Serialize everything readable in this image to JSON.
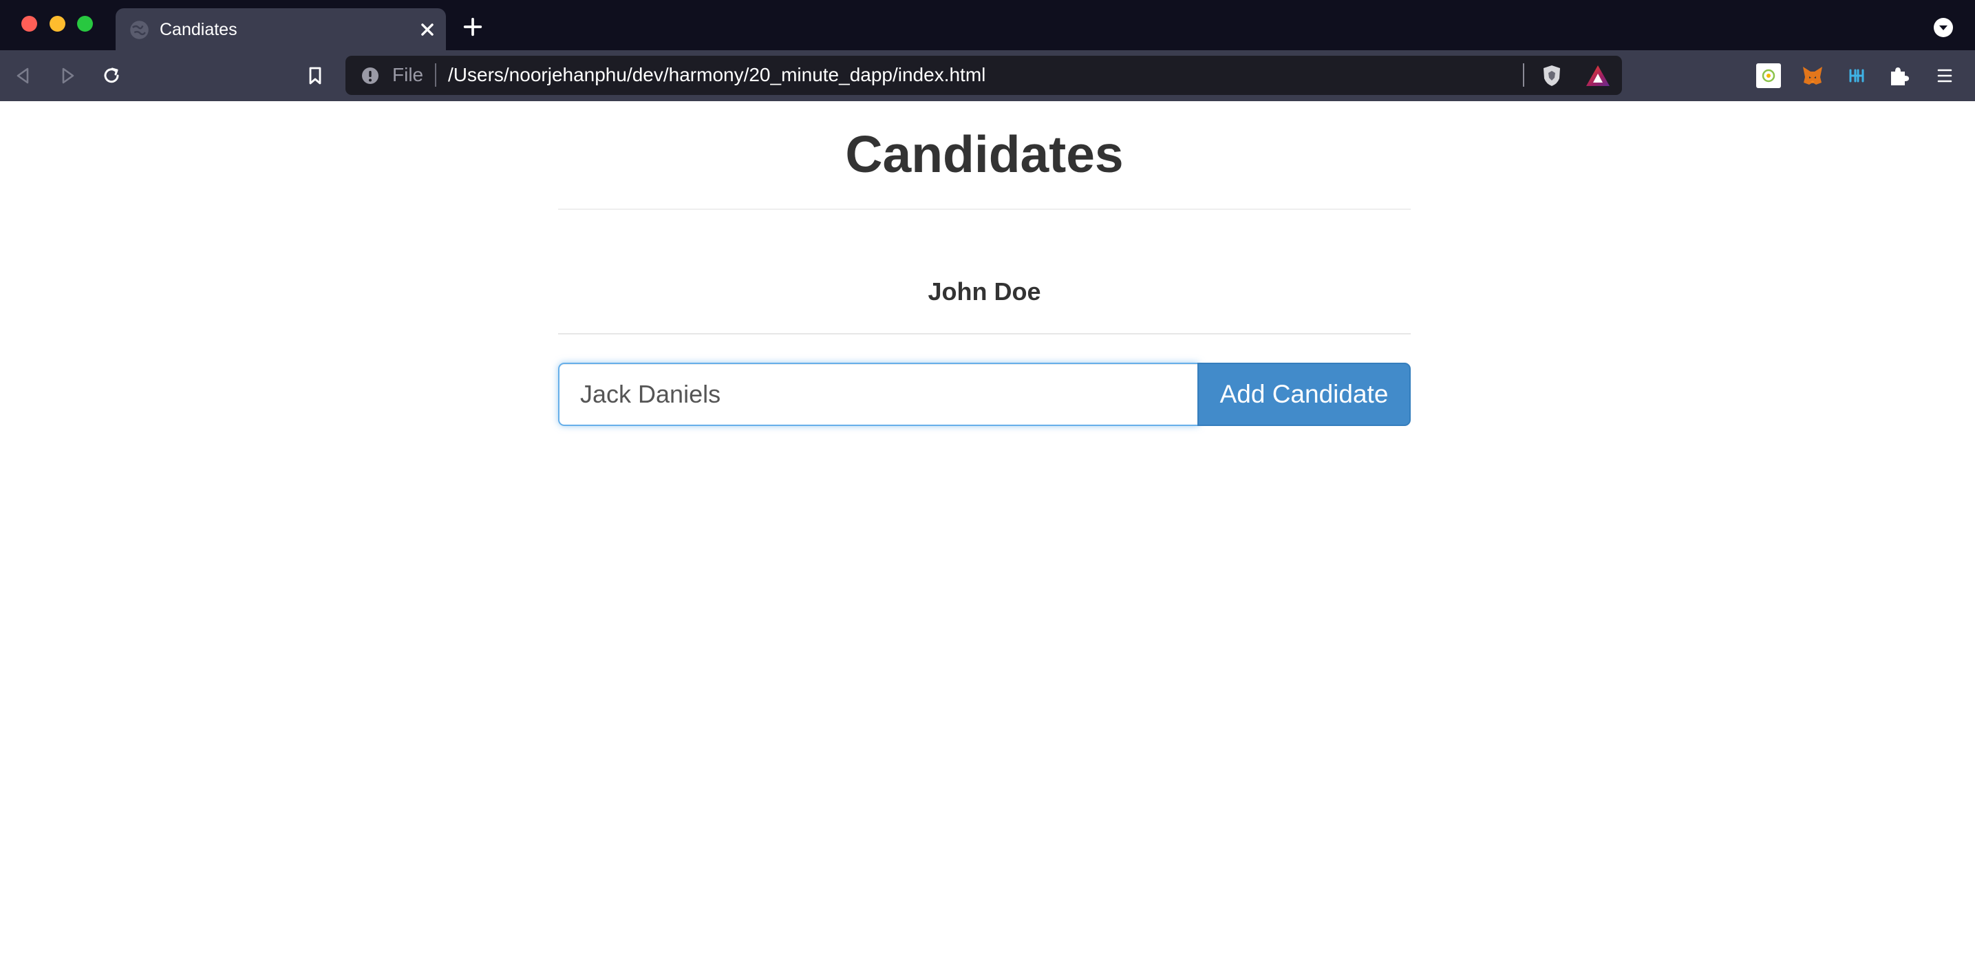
{
  "browser": {
    "tab": {
      "title": "Candiates"
    },
    "url": {
      "scheme": "File",
      "path": "/Users/noorjehanphu/dev/harmony/20_minute_dapp/index.html"
    },
    "icons": [
      "globe-favicon-icon",
      "close-icon",
      "plus-icon",
      "chevron-down-icon",
      "back-arrow-icon",
      "forward-arrow-icon",
      "reload-icon",
      "bookmark-icon",
      "info-icon",
      "brave-shield-icon",
      "brave-rewards-icon",
      "extension-icon",
      "metamask-fox-icon",
      "harmony-icon",
      "puzzle-icon",
      "menu-icon"
    ]
  },
  "page": {
    "title": "Candidates",
    "candidates": [
      "John Doe"
    ],
    "form": {
      "input_value": "Jack Daniels",
      "button_label": "Add Candidate"
    }
  },
  "colors": {
    "tabstrip": "#0f0f1e",
    "toolbar": "#3b3d4f",
    "urlbar": "#1c1c24",
    "primary_button": "#428bca",
    "input_focus_border": "#66afe9",
    "heading_text": "#333333"
  }
}
